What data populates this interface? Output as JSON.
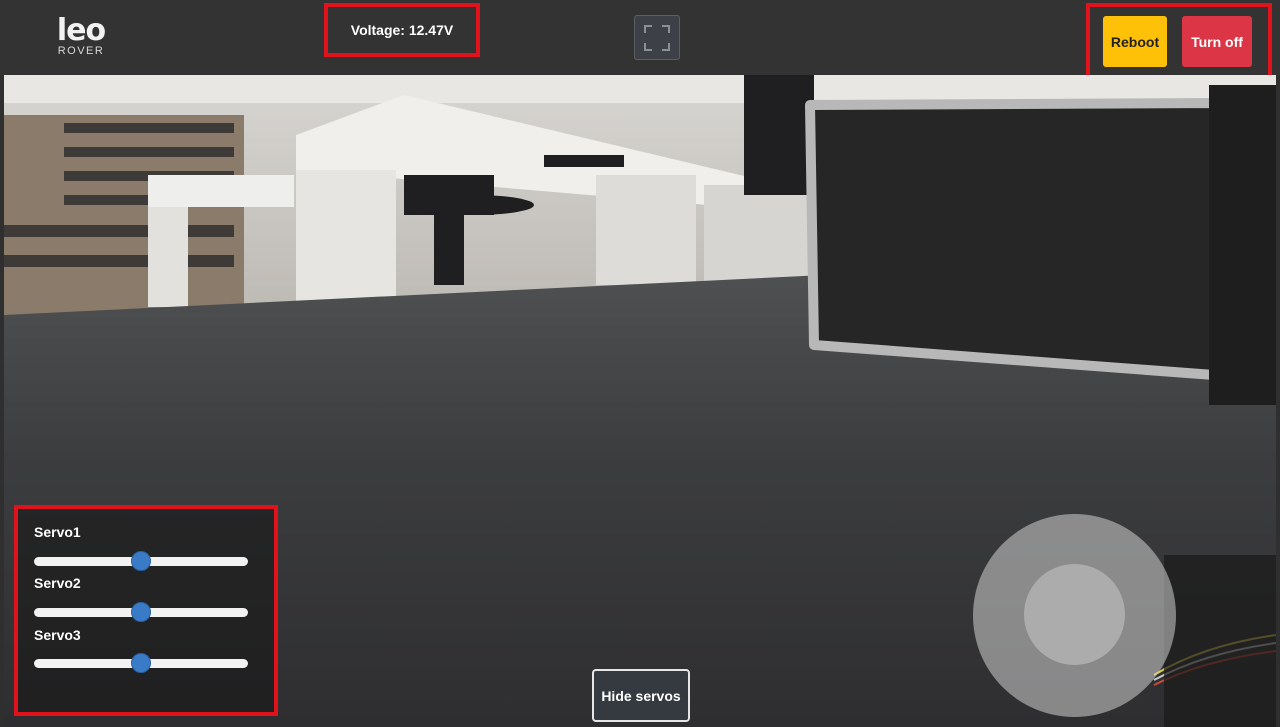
{
  "header": {
    "logo_text": "leo",
    "logo_subtext": "ROVER",
    "voltage_label": "Voltage: 12.47V",
    "reboot_label": "Reboot",
    "turnoff_label": "Turn off"
  },
  "icons": {
    "fullscreen": "fullscreen-icon"
  },
  "servos": [
    {
      "label": "Servo1",
      "value_fraction": 0.5
    },
    {
      "label": "Servo2",
      "value_fraction": 0.5
    },
    {
      "label": "Servo3",
      "value_fraction": 0.5
    }
  ],
  "controls": {
    "hide_servos_label": "Hide servos"
  },
  "colors": {
    "reboot": "#ffc107",
    "turnoff": "#dc3545",
    "highlight": "#e0121b",
    "slider_thumb": "#3a7bc8"
  }
}
